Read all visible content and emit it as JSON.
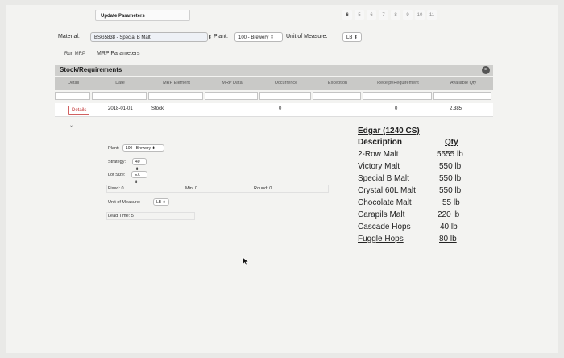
{
  "header": {
    "tab_label": "Update Parameters",
    "pages": [
      "6",
      "5",
      "6",
      "7",
      "8",
      "9",
      "10",
      "11"
    ]
  },
  "material": {
    "label": "Material:",
    "value": "BSG5838 - Special B Malt",
    "plant_label": "Plant:",
    "plant_value": "100 - Brewery",
    "uom_label": "Unit of Measure:",
    "uom_value": "LB"
  },
  "links": {
    "run_mrp": "Run MRP",
    "mrp_parameters": "MRP Parameters"
  },
  "stock_panel": {
    "title": "Stock/Requirements",
    "columns": [
      "Detail",
      "Date",
      "MRP Element",
      "MRP Data",
      "Occurrence",
      "Exception",
      "Receipt/Requirement",
      "Available Qty"
    ],
    "row": {
      "detail_button": "Details",
      "date": "2018-01-01",
      "mrp_element": "Stock",
      "occurrence": "0",
      "receipt": "0",
      "available": "2,385"
    }
  },
  "params": {
    "plant_label": "Plant:",
    "plant_value": "100 - Brewery",
    "strategy_label": "Strategy:",
    "strategy_value": "40",
    "lot_size_label": "Lot Size:",
    "lot_size_value": "EX",
    "fixed_label": "Fixed:",
    "fixed_value": "0",
    "min_label": "Min:",
    "min_value": "0",
    "round_label": "Round:",
    "round_value": "0",
    "uom_label": "Unit of Measure:",
    "uom_value": "LB",
    "lead_time_label": "Lead Time:",
    "lead_time_value": "5"
  },
  "recipe": {
    "title": "Edgar (1240 CS)",
    "col_description": "Description",
    "col_qty": "Qty",
    "items": [
      {
        "desc": "2-Row Malt",
        "qty": "5555 lb"
      },
      {
        "desc": "Victory Malt",
        "qty": "550 lb"
      },
      {
        "desc": "Special B Malt",
        "qty": "550 lb"
      },
      {
        "desc": "Crystal 60L Malt",
        "qty": "550 lb"
      },
      {
        "desc": "Chocolate Malt",
        "qty": "55 lb"
      },
      {
        "desc": "Carapils Malt",
        "qty": "220 lb"
      },
      {
        "desc": "Cascade Hops",
        "qty": "40 lb"
      },
      {
        "desc": "Fuggle Hops",
        "qty": "80 lb"
      }
    ]
  }
}
